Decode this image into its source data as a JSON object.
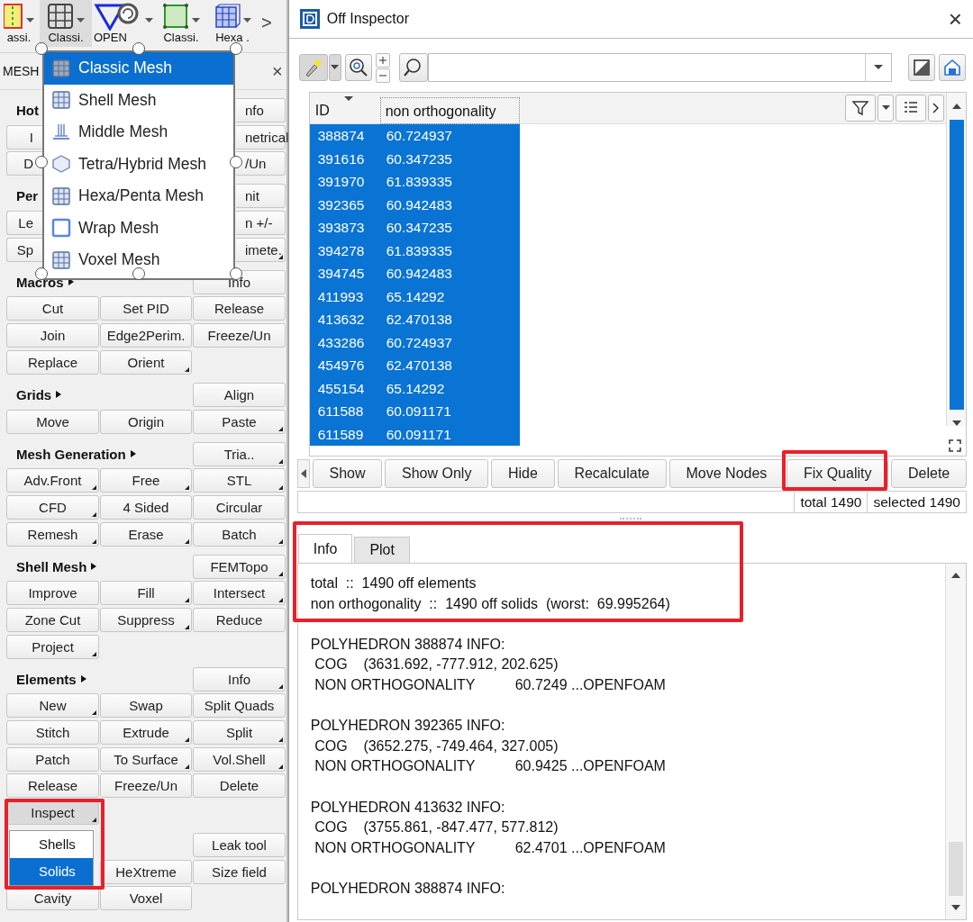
{
  "toolbar": {
    "items": [
      {
        "label": "assi.",
        "selected": false
      },
      {
        "label": "Classi.",
        "selected": true
      },
      {
        "label": "OPEN",
        "selected": false
      },
      {
        "label": "Classi.",
        "selected": false
      },
      {
        "label": "Hexa .",
        "selected": false
      }
    ],
    "more": ">"
  },
  "panel": {
    "tab": "MESH",
    "close": "×",
    "sections": [
      {
        "title": "Hot",
        "header_button": {
          "label": "nfo",
          "kind": "right-edge",
          "menu": false
        },
        "rows": [
          [
            {
              "label": "I",
              "kind": "left-edge",
              "menu": false
            },
            null,
            {
              "label": "netrical",
              "kind": "right-edge",
              "menu": false
            }
          ],
          [
            {
              "label": "D",
              "kind": "left-edge",
              "menu": false
            },
            null,
            {
              "label": "/Un",
              "kind": "right-edge",
              "menu": false
            }
          ]
        ]
      },
      {
        "title": "Per",
        "header_button": {
          "label": "nit",
          "kind": "right-edge",
          "menu": false
        },
        "rows": [
          [
            {
              "label": "Le",
              "kind": "left-edge",
              "menu": false
            },
            null,
            {
              "label": "n +/-",
              "kind": "right-edge",
              "menu": false
            }
          ],
          [
            {
              "label": "Sp",
              "kind": "left-edge",
              "menu": false
            },
            null,
            {
              "label": "imete.",
              "kind": "right-edge",
              "menu": true
            }
          ]
        ]
      },
      {
        "title": "Macros",
        "arrow": true,
        "header_button": {
          "label": "Info",
          "kind": "button",
          "menu": false
        },
        "rows": [
          [
            {
              "label": "Cut",
              "kind": "button",
              "menu": false
            },
            {
              "label": "Set PID",
              "kind": "button",
              "menu": false
            },
            {
              "label": "Release",
              "kind": "button",
              "menu": false
            }
          ],
          [
            {
              "label": "Join",
              "kind": "button",
              "menu": false
            },
            {
              "label": "Edge2Perim.",
              "kind": "button",
              "menu": false
            },
            {
              "label": "Freeze/Un",
              "kind": "button",
              "menu": false
            }
          ],
          [
            {
              "label": "Replace",
              "kind": "button",
              "menu": false
            },
            {
              "label": "Orient",
              "kind": "button",
              "menu": true
            },
            null
          ]
        ]
      },
      {
        "title": "Grids",
        "arrow": true,
        "header_button": {
          "label": "Align",
          "kind": "button",
          "menu": false
        },
        "rows": [
          [
            {
              "label": "Move",
              "kind": "button",
              "menu": false
            },
            {
              "label": "Origin",
              "kind": "button",
              "menu": false
            },
            {
              "label": "Paste",
              "kind": "button",
              "menu": true
            }
          ]
        ]
      },
      {
        "title": "Mesh Generation",
        "arrow": true,
        "header_button": {
          "label": "Tria..",
          "kind": "button",
          "menu": true
        },
        "rows": [
          [
            {
              "label": "Adv.Front",
              "kind": "button",
              "menu": true
            },
            {
              "label": "Free",
              "kind": "button",
              "menu": true
            },
            {
              "label": "STL",
              "kind": "button",
              "menu": true
            }
          ],
          [
            {
              "label": "CFD",
              "kind": "button",
              "menu": true
            },
            {
              "label": "4 Sided",
              "kind": "button",
              "menu": false
            },
            {
              "label": "Circular",
              "kind": "button",
              "menu": false
            }
          ],
          [
            {
              "label": "Remesh",
              "kind": "button",
              "menu": true
            },
            {
              "label": "Erase",
              "kind": "button",
              "menu": true
            },
            {
              "label": "Batch",
              "kind": "button",
              "menu": true
            }
          ]
        ]
      },
      {
        "title": "Shell Mesh",
        "arrow": true,
        "header_button": {
          "label": "FEMTopo",
          "kind": "button",
          "menu": true
        },
        "rows": [
          [
            {
              "label": "Improve",
              "kind": "button",
              "menu": false
            },
            {
              "label": "Fill",
              "kind": "button",
              "menu": true
            },
            {
              "label": "Intersect",
              "kind": "button",
              "menu": true
            }
          ],
          [
            {
              "label": "Zone Cut",
              "kind": "button",
              "menu": false
            },
            {
              "label": "Suppress",
              "kind": "button",
              "menu": true
            },
            {
              "label": "Reduce",
              "kind": "button",
              "menu": false
            }
          ],
          [
            {
              "label": "Project",
              "kind": "button",
              "menu": true
            },
            null,
            null
          ]
        ]
      },
      {
        "title": "Elements",
        "arrow": true,
        "header_button": {
          "label": "Info",
          "kind": "button",
          "menu": true
        },
        "rows": [
          [
            {
              "label": "New",
              "kind": "button",
              "menu": true
            },
            {
              "label": "Swap",
              "kind": "button",
              "menu": false
            },
            {
              "label": "Split Quads",
              "kind": "button",
              "menu": false
            }
          ],
          [
            {
              "label": "Stitch",
              "kind": "button",
              "menu": false
            },
            {
              "label": "Extrude",
              "kind": "button",
              "menu": true
            },
            {
              "label": "Split",
              "kind": "button",
              "menu": true
            }
          ],
          [
            {
              "label": "Patch",
              "kind": "button",
              "menu": false
            },
            {
              "label": "To Surface",
              "kind": "button",
              "menu": true
            },
            {
              "label": "Vol.Shell",
              "kind": "button",
              "menu": true
            }
          ],
          [
            {
              "label": "Release",
              "kind": "button",
              "menu": false
            },
            {
              "label": "Freeze/Un",
              "kind": "button",
              "menu": false
            },
            {
              "label": "Delete",
              "kind": "button",
              "menu": false
            }
          ],
          [
            {
              "label": "Inspect",
              "kind": "button",
              "menu": true,
              "pressed": true
            },
            null,
            null
          ]
        ]
      },
      {
        "header_button": {
          "label": "Leak tool",
          "kind": "button",
          "menu": false
        },
        "rows": [
          [
            null,
            {
              "label": "HeXtreme",
              "kind": "button",
              "menu": false
            },
            {
              "label": "Size field",
              "kind": "button",
              "menu": false
            }
          ],
          [
            {
              "label": "Cavity",
              "kind": "button",
              "menu": false
            },
            {
              "label": "Voxel",
              "kind": "button",
              "menu": false
            },
            null
          ]
        ]
      }
    ]
  },
  "mesh_menu": {
    "items": [
      {
        "label": "Classic Mesh",
        "selected": true
      },
      {
        "label": "Shell Mesh",
        "selected": false
      },
      {
        "label": "Middle Mesh",
        "selected": false
      },
      {
        "label": "Tetra/Hybrid Mesh",
        "selected": false
      },
      {
        "label": "Hexa/Penta Mesh",
        "selected": false
      },
      {
        "label": "Wrap Mesh",
        "selected": false
      },
      {
        "label": "Voxel Mesh",
        "selected": false
      }
    ]
  },
  "inspect_popup": {
    "items": [
      {
        "label": "Shells",
        "selected": false
      },
      {
        "label": "Solids",
        "selected": true
      }
    ]
  },
  "inspector": {
    "title": "Off Inspector",
    "close": "×",
    "table": {
      "columns": [
        "ID",
        "non orthogonality"
      ],
      "rows": [
        {
          "cells": [
            "388874",
            "60.724937"
          ],
          "selected": true
        },
        {
          "cells": [
            "391616",
            "60.347235"
          ],
          "selected": true
        },
        {
          "cells": [
            "391970",
            "61.839335"
          ],
          "selected": true
        },
        {
          "cells": [
            "392365",
            "60.942483"
          ],
          "selected": true
        },
        {
          "cells": [
            "393873",
            "60.347235"
          ],
          "selected": true
        },
        {
          "cells": [
            "394278",
            "61.839335"
          ],
          "selected": true
        },
        {
          "cells": [
            "394745",
            "60.942483"
          ],
          "selected": true
        },
        {
          "cells": [
            "411993",
            "65.14292"
          ],
          "selected": true
        },
        {
          "cells": [
            "413632",
            "62.470138"
          ],
          "selected": true
        },
        {
          "cells": [
            "433286",
            "60.724937"
          ],
          "selected": true
        },
        {
          "cells": [
            "454976",
            "62.470138"
          ],
          "selected": true
        },
        {
          "cells": [
            "455154",
            "65.14292"
          ],
          "selected": true
        },
        {
          "cells": [
            "611588",
            "60.091171"
          ],
          "selected": true
        },
        {
          "cells": [
            "611589",
            "60.091171"
          ],
          "selected": true
        }
      ]
    },
    "actions": [
      "Show",
      "Show Only",
      "Hide",
      "Recalculate",
      "Move Nodes",
      "Fix Quality",
      "Delete"
    ],
    "status": {
      "total": "total 1490",
      "selected": "selected 1490"
    },
    "tabs": [
      {
        "label": "Info",
        "selected": true
      },
      {
        "label": "Plot",
        "selected": false
      }
    ],
    "info": {
      "summary": [
        "total  ::  1490 off elements",
        "non orthogonality  ::  1490 off solids  (worst:  69.995264)"
      ],
      "blocks": [
        {
          "title": "POLYHEDRON 388874 INFO:",
          "lines": [
            " COG    (3631.692, -777.912, 202.625)",
            " NON ORTHOGONALITY          60.7249 ...OPENFOAM"
          ]
        },
        {
          "title": "POLYHEDRON 392365 INFO:",
          "lines": [
            " COG    (3652.275, -749.464, 327.005)",
            " NON ORTHOGONALITY          60.9425 ...OPENFOAM"
          ]
        },
        {
          "title": "POLYHEDRON 413632 INFO:",
          "lines": [
            " COG    (3755.861, -847.477, 577.812)",
            " NON ORTHOGONALITY          62.4701 ...OPENFOAM"
          ]
        },
        {
          "title": "POLYHEDRON 388874 INFO:"
        }
      ]
    }
  }
}
